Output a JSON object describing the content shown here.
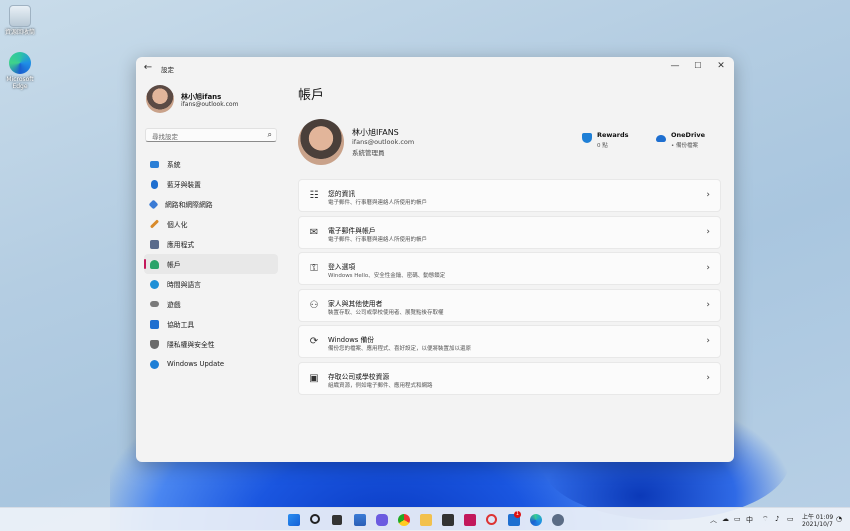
{
  "desktop": {
    "icons": [
      {
        "label": "資源回收筒"
      },
      {
        "label": "Microsoft Edge"
      }
    ]
  },
  "window": {
    "title": "設定",
    "controls": {
      "minimize": "—",
      "maximize": "☐",
      "close": "✕"
    }
  },
  "sidebar": {
    "profile": {
      "name": "林小旭ifans",
      "email": "ifans@outlook.com"
    },
    "search_placeholder": "尋找設定",
    "items": [
      {
        "label": "系統",
        "color": "#2b7fd6"
      },
      {
        "label": "藍牙與裝置",
        "color": "#1e6fd0"
      },
      {
        "label": "網路和網際網路",
        "color": "#3a7bd5"
      },
      {
        "label": "個人化",
        "color": "#d88a2a"
      },
      {
        "label": "應用程式",
        "color": "#5a6b8c"
      },
      {
        "label": "帳戶",
        "color": "#2aa36a"
      },
      {
        "label": "時間與語言",
        "color": "#1e8fd6"
      },
      {
        "label": "遊戲",
        "color": "#7a7a7a"
      },
      {
        "label": "協助工具",
        "color": "#1e6fd0"
      },
      {
        "label": "隱私權與安全性",
        "color": "#6b6b6b"
      },
      {
        "label": "Windows Update",
        "color": "#1e7fd6"
      }
    ],
    "active_index": 5
  },
  "main": {
    "title": "帳戶",
    "account": {
      "name": "林小旭IFANS",
      "email": "ifans@outlook.com",
      "role": "系統管理員"
    },
    "rewards": {
      "title": "Rewards",
      "sub": "0 點"
    },
    "onedrive": {
      "title": "OneDrive",
      "sub": "• 備份檔案"
    },
    "cards": [
      {
        "icon": "person-card-icon",
        "glyph": "☷",
        "title": "您的資訊",
        "sub": "電子郵件、行事曆與連絡人所使用的帳戶"
      },
      {
        "icon": "mail-icon",
        "glyph": "✉",
        "title": "電子郵件與帳戶",
        "sub": "電子郵件、行事曆與連絡人所使用的帳戶"
      },
      {
        "icon": "key-icon",
        "glyph": "⚿",
        "title": "登入選項",
        "sub": "Windows Hello、安全性金鑰、密碼、動態鎖定"
      },
      {
        "icon": "family-icon",
        "glyph": "⚇",
        "title": "家人與其他使用者",
        "sub": "裝置存取、公司或學校使用者、展覽點後存取權"
      },
      {
        "icon": "backup-icon",
        "glyph": "⟳",
        "title": "Windows 備份",
        "sub": "備份您的檔案、應用程式、喜好設定，以便將裝置加以還原"
      },
      {
        "icon": "briefcase-icon",
        "glyph": "▣",
        "title": "存取公司或學校資源",
        "sub": "組織資源，例如電子郵件、應用程式和網路"
      }
    ],
    "chevron": "›"
  },
  "taskbar": {
    "mail_badge": "1",
    "ime": "中",
    "time": "上午 01:09",
    "date": "2021/10/7"
  }
}
